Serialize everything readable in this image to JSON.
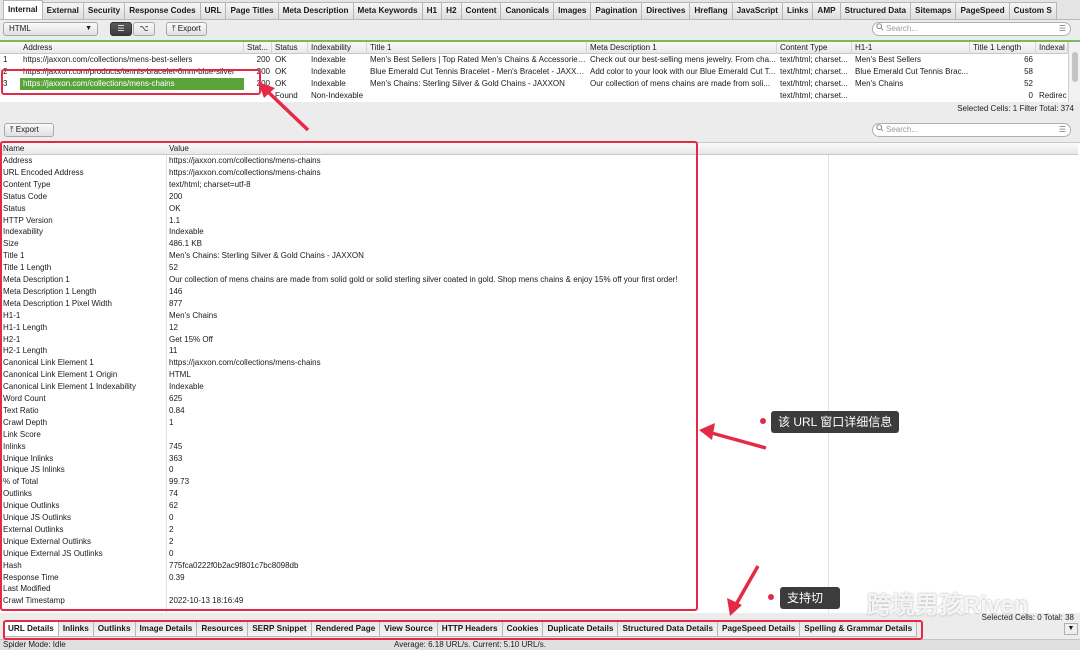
{
  "top_tabs": [
    "Internal",
    "External",
    "Security",
    "Response Codes",
    "URL",
    "Page Titles",
    "Meta Description",
    "Meta Keywords",
    "H1",
    "H2",
    "Content",
    "Canonicals",
    "Images",
    "Pagination",
    "Directives",
    "Hreflang",
    "JavaScript",
    "Links",
    "AMP",
    "Structured Data",
    "Sitemaps",
    "PageSpeed",
    "Custom S"
  ],
  "toolbar": {
    "filter_value": "HTML",
    "export_label": "Export",
    "search_placeholder": "Search..."
  },
  "url_table": {
    "columns": [
      "Address",
      "Stat...",
      "Status",
      "Indexability",
      "Title 1",
      "Meta Description 1",
      "Content Type",
      "H1-1",
      "Title 1 Length",
      "Indexal"
    ],
    "rows": [
      {
        "num": "1",
        "address": "https://jaxxon.com/collections/mens-best-sellers",
        "code": "200",
        "status": "OK",
        "indexability": "Indexable",
        "title": "Men's Best Sellers | Top Rated Men's Chains & Accessories...",
        "meta": "Check out our best-selling mens jewelry. From cha...",
        "ctype": "text/html; charset...",
        "h1": "Men's Best Sellers",
        "tlen": "66",
        "idx": ""
      },
      {
        "num": "2",
        "address": "https://jaxxon.com/products/tennis-bracelet-6mm-blue-silver",
        "code": "200",
        "status": "OK",
        "indexability": "Indexable",
        "title": "Blue Emerald Cut Tennis Bracelet - Men's Bracelet - JAXXON",
        "meta": "Add color to your look with our Blue Emerald Cut T...",
        "ctype": "text/html; charset...",
        "h1": "Blue Emerald Cut Tennis Brac...",
        "tlen": "58",
        "idx": ""
      },
      {
        "num": "3",
        "address": "https://jaxxon.com/collections/mens-chains",
        "code": "200",
        "status": "OK",
        "indexability": "Indexable",
        "title": "Men's Chains: Sterling Silver & Gold Chains - JAXXON",
        "meta": "Our collection of mens chains are made from soli...",
        "ctype": "text/html; charset...",
        "h1": "Men's Chains",
        "tlen": "52",
        "idx": ""
      },
      {
        "num": "",
        "address": "",
        "code": "",
        "status": "Found",
        "indexability": "Non-Indexable",
        "title": "",
        "meta": "",
        "ctype": "text/html; charset...",
        "h1": "",
        "tlen": "0",
        "idx": "Redirec"
      }
    ]
  },
  "status_top": "Selected Cells:  1  Filter Total:  374",
  "details": {
    "export_label": "Export",
    "search_placeholder": "Search...",
    "head_name": "Name",
    "head_value": "Value",
    "rows": [
      [
        "Address",
        "https://jaxxon.com/collections/mens-chains"
      ],
      [
        "URL Encoded Address",
        "https://jaxxon.com/collections/mens-chains"
      ],
      [
        "Content Type",
        "text/html; charset=utf-8"
      ],
      [
        "Status Code",
        "200"
      ],
      [
        "Status",
        "OK"
      ],
      [
        "HTTP Version",
        "1.1"
      ],
      [
        "Indexability",
        "Indexable"
      ],
      [
        "Size",
        "486.1 KB"
      ],
      [
        "Title 1",
        "Men's Chains: Sterling Silver & Gold Chains - JAXXON"
      ],
      [
        "Title 1 Length",
        "52"
      ],
      [
        "Meta Description 1",
        "Our collection of mens chains are made from solid gold or solid sterling silver coated in gold. Shop mens chains & enjoy 15% off your first order!"
      ],
      [
        "Meta Description 1 Length",
        "146"
      ],
      [
        "Meta Description 1 Pixel Width",
        "877"
      ],
      [
        "H1-1",
        "Men's Chains"
      ],
      [
        "H1-1 Length",
        "12"
      ],
      [
        "H2-1",
        "Get 15% Off"
      ],
      [
        "H2-1 Length",
        "11"
      ],
      [
        "Canonical Link Element 1",
        "https://jaxxon.com/collections/mens-chains"
      ],
      [
        "Canonical Link Element 1 Origin",
        "HTML"
      ],
      [
        "Canonical Link Element 1 Indexability",
        "Indexable"
      ],
      [
        "Word Count",
        "625"
      ],
      [
        "Text Ratio",
        "0.84"
      ],
      [
        "Crawl Depth",
        "1"
      ],
      [
        "Link Score",
        ""
      ],
      [
        "Inlinks",
        "745"
      ],
      [
        "Unique Inlinks",
        "363"
      ],
      [
        "Unique JS Inlinks",
        "0"
      ],
      [
        "% of Total",
        "99.73"
      ],
      [
        "Outlinks",
        "74"
      ],
      [
        "Unique Outlinks",
        "62"
      ],
      [
        "Unique JS Outlinks",
        "0"
      ],
      [
        "External Outlinks",
        "2"
      ],
      [
        "Unique External Outlinks",
        "2"
      ],
      [
        "Unique External JS Outlinks",
        "0"
      ],
      [
        "Hash",
        "775fca0222f0b2ac9f801c7bc8098db"
      ],
      [
        "Response Time",
        "0.39"
      ],
      [
        "Last Modified",
        ""
      ],
      [
        "Crawl Timestamp",
        "2022-10-13 18:16:49"
      ]
    ]
  },
  "status_bottom": "Selected Cells:  0  Total:  38",
  "bottom_tabs": [
    "URL Details",
    "Inlinks",
    "Outlinks",
    "Image Details",
    "Resources",
    "SERP Snippet",
    "Rendered Page",
    "View Source",
    "HTTP Headers",
    "Cookies",
    "Duplicate Details",
    "Structured Data Details",
    "PageSpeed Details",
    "Spelling & Grammar Details"
  ],
  "footer": {
    "spider_mode": "Spider Mode: Idle",
    "speed": "Average: 6.18 URL/s. Current: 5.10 URL/s."
  },
  "annotations": {
    "detail_note": "该 URL 窗口详细信息",
    "tabs_note": "支持切",
    "watermark": "跨境男孩Riven"
  },
  "colors": {
    "selection_green": "#59a43a",
    "annotation_red": "#e62a46",
    "note_bg": "#3c3c3c"
  }
}
